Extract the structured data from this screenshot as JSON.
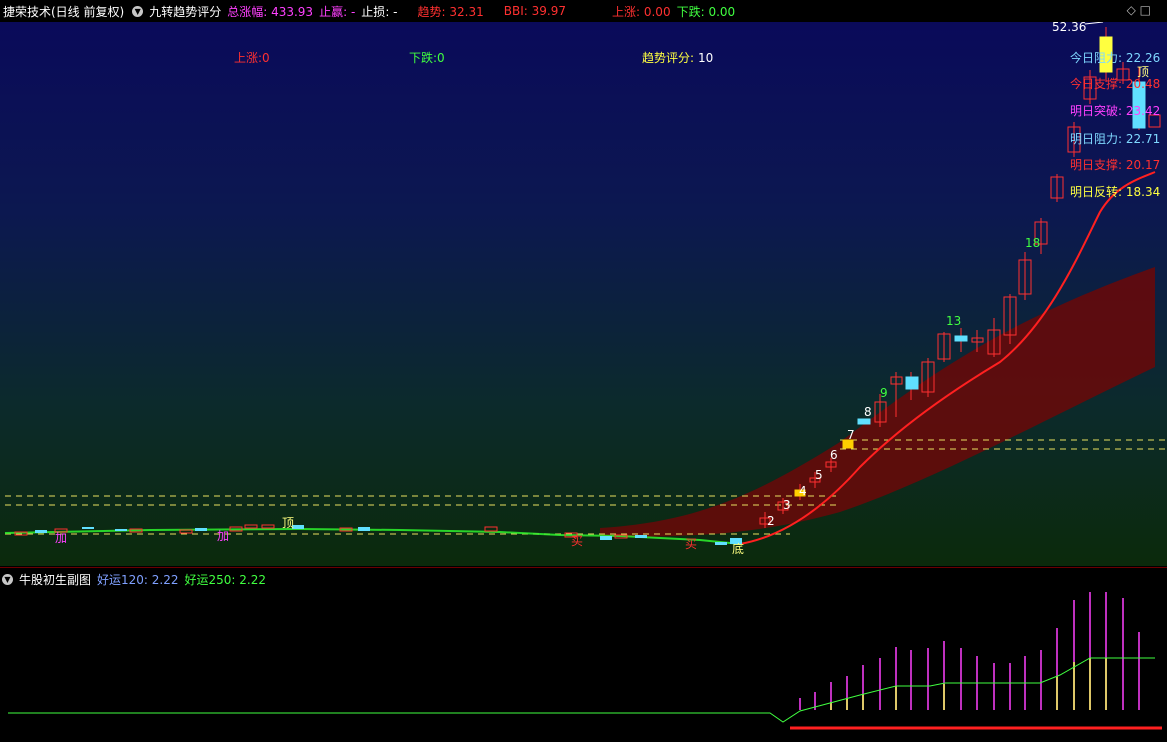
{
  "header": {
    "title": "捷荣技术(日线 前复权)",
    "indicator_name": "九转趋势评分",
    "stats": [
      {
        "label": "总涨幅",
        "value": "433.93",
        "color": "#ff40ff"
      },
      {
        "label": "止赢",
        "value": "-",
        "color": "#ff40ff"
      },
      {
        "label": "止损",
        "value": "-",
        "color": "#ffffff"
      },
      {
        "label": "趋势",
        "value": "32.31",
        "color": "#ff3030"
      },
      {
        "label": "BBI",
        "value": "39.97",
        "color": "#ff3030"
      },
      {
        "label": "上涨",
        "value": "0.00",
        "color": "#ff3030"
      },
      {
        "label": "下跌",
        "value": "0.00",
        "color": "#40ff40"
      }
    ],
    "window_icons": "◇ □"
  },
  "main": {
    "overlay": {
      "up_count": "上涨:0",
      "down_count": "下跌:0",
      "trend_score_label": "趋势评分:",
      "trend_score_value": "10"
    },
    "price_high_marker": "52.36",
    "levels": [
      {
        "label": "今日阻力",
        "value": "22.26",
        "color": "#7fd8ff"
      },
      {
        "label": "今日支撑",
        "value": "20.48",
        "color": "#ff3030"
      },
      {
        "label": "明日突破",
        "value": "23.42",
        "color": "#ff40ff"
      },
      {
        "label": "明日阻力",
        "value": "22.71",
        "color": "#7fd8ff"
      },
      {
        "label": "明日支撑",
        "value": "20.17",
        "color": "#ff3030"
      },
      {
        "label": "明日反转",
        "value": "18.34",
        "color": "#ffff40"
      }
    ],
    "signal_top": "顶",
    "signal_add": "加",
    "signal_buy": "买",
    "signal_bottom": "底",
    "nine_count_labels": [
      "13",
      "9",
      "8",
      "7",
      "6",
      "5",
      "4",
      "3",
      "2",
      "18"
    ]
  },
  "sub": {
    "title": "牛股初生副图",
    "good_luck_120_label": "好运120",
    "good_luck_120_value": "2.22",
    "good_luck_250_label": "好运250",
    "good_luck_250_value": "2.22"
  },
  "colors": {
    "up": "#ff3030",
    "down": "#60e0ff",
    "ma_line": "#ff2020",
    "band": "#7a0a0a",
    "support_dash": "#e8e060"
  }
}
